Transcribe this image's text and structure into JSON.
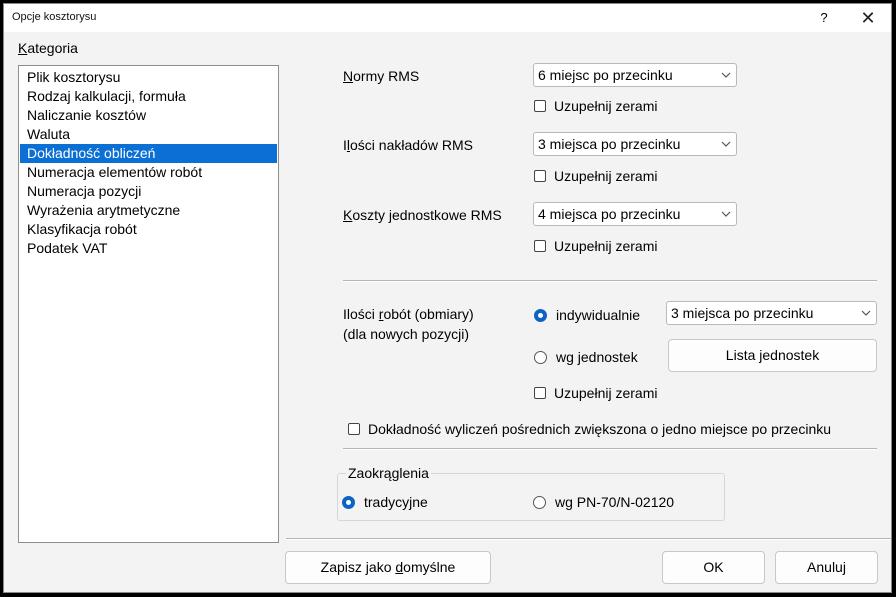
{
  "window": {
    "title": "Opcje kosztorysu",
    "help_label": "?",
    "close_label": "✕"
  },
  "category": {
    "label_u": "K",
    "label_rest": "ategoria",
    "items": [
      "Plik kosztorysu",
      "Rodzaj kalkulacji, formuła",
      "Naliczanie kosztów",
      "Waluta",
      "Dokładność obliczeń",
      "Numeracja elementów robót",
      "Numeracja pozycji",
      "Wyrażenia arytmetyczne",
      "Klasyfikacja robót",
      "Podatek VAT"
    ],
    "selected": "Dokładność obliczeń"
  },
  "rms": {
    "norms_u": "N",
    "norms_rest": "ormy RMS",
    "norms_value": "6 miejsc po przecinku",
    "qty_pre": "I",
    "qty_u": "l",
    "qty_rest": "ości nakładów RMS",
    "qty_value": "3 miejsca po przecinku",
    "unit_u": "K",
    "unit_rest": "oszty jednostkowe RMS",
    "unit_value": "4 miejsca po przecinku",
    "fill_zeros": "Uzupełnij zerami"
  },
  "works": {
    "label_pre": "Ilości ",
    "label_u": "r",
    "label_rest": "obót (obmiary)",
    "label_line2": "(dla nowych pozycji)",
    "opt_individual": "indywidualnie",
    "opt_by_units": "wg jednostek",
    "precision_value": "3 miejsca po przecinku",
    "unit_list_button": "Lista jednostek",
    "fill_zeros": "Uzupełnij zerami",
    "selected": "indywidualnie"
  },
  "intermediate": {
    "label": "Dokładność wyliczeń pośrednich zwiększona o jedno miejsce po przecinku"
  },
  "rounding": {
    "title": "Zaokrąglenia",
    "opt_traditional": "tradycyjne",
    "opt_pn": "wg PN-70/N-02120",
    "selected": "tradycyjne"
  },
  "footer": {
    "save_default_pre": "Zapisz jako ",
    "save_default_u": "d",
    "save_default_rest": "omyślne",
    "ok": "OK",
    "cancel": "Anuluj"
  }
}
